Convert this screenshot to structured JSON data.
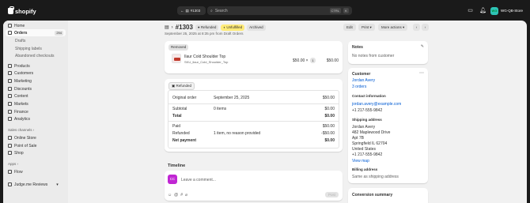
{
  "topbar": {
    "brand": "shopify",
    "order_pill": "#1303",
    "search_placeholder": "Search",
    "shortcut_1": "CTRL",
    "shortcut_2": "K",
    "store_initials": "WG",
    "store_name": "WG-QB-Store"
  },
  "sidebar": {
    "items": [
      {
        "label": "Home",
        "icon": "home-icon"
      },
      {
        "label": "Orders",
        "icon": "orders-icon",
        "badge": "294"
      },
      {
        "label": "Drafts"
      },
      {
        "label": "Shipping labels"
      },
      {
        "label": "Abandoned checkouts"
      },
      {
        "label": "Products",
        "icon": "tag-icon"
      },
      {
        "label": "Customers",
        "icon": "person-icon"
      },
      {
        "label": "Marketing",
        "icon": "target-icon"
      },
      {
        "label": "Discounts",
        "icon": "discount-icon"
      },
      {
        "label": "Content",
        "icon": "content-icon"
      },
      {
        "label": "Markets",
        "icon": "globe-icon"
      },
      {
        "label": "Finance",
        "icon": "bank-icon"
      },
      {
        "label": "Analytics",
        "icon": "chart-icon"
      }
    ],
    "sales_channels_label": "Sales channels",
    "channels": [
      {
        "label": "Online Store",
        "icon": "store-icon"
      },
      {
        "label": "Point of Sale",
        "icon": "pos-icon"
      },
      {
        "label": "Shop",
        "icon": "shop-icon"
      }
    ],
    "apps_label": "Apps",
    "apps": [
      {
        "label": "Flow",
        "icon": "flow-icon"
      }
    ],
    "judge": {
      "label": "Judge.me Reviews",
      "icon": "judge-icon"
    }
  },
  "order": {
    "number": "#1303",
    "status_refunded": "Refunded",
    "status_unfulfilled": "Unfulfilled",
    "status_archived": "Archived",
    "subtitle": "September 25, 2025 at 8:35 pm from Draft Orders",
    "actions": {
      "edit": "Edit",
      "print": "Print",
      "more": "More actions"
    }
  },
  "removed": {
    "label": "Removed",
    "item_name": "Ilaur Cold Shoulder Top",
    "item_sku": "SKU_ilaur_Cold_Shoulder_Top",
    "item_price": "$50.00 ×",
    "item_qty": "1",
    "item_total": "$50.00"
  },
  "summary": {
    "label": "Refunded",
    "rows": [
      {
        "label": "Original order",
        "detail": "September 25, 2025",
        "amount": "$50.00"
      },
      {
        "label": "Subtotal",
        "detail": "0 items",
        "amount": "$0.00"
      },
      {
        "label": "Total",
        "detail": "",
        "amount": "$0.00"
      },
      {
        "label": "Paid",
        "detail": "",
        "amount": "$50.00"
      },
      {
        "label": "Refunded",
        "detail": "1 item, no reason provided",
        "amount": "-$50.00"
      },
      {
        "label": "Net payment",
        "detail": "",
        "amount": "$0.00"
      }
    ]
  },
  "timeline": {
    "title": "Timeline",
    "avatar": "CC",
    "placeholder": "Leave a comment...",
    "post": "Post"
  },
  "notes": {
    "title": "Notes",
    "text": "No notes from customer"
  },
  "customer": {
    "title": "Customer",
    "name": "Jordan Avery",
    "orders": "3 orders",
    "contact_title": "Contact information",
    "email": "jordan.avery@example.com",
    "phone": "+1 217-555-9842",
    "shipping_title": "Shipping address",
    "address": [
      "Jordan Avery",
      "482 Maplewood Drive",
      "Apt 7B",
      "Springfield IL 62704",
      "United States",
      "+1 217-555-9842"
    ],
    "view_map": "View map",
    "billing_title": "Billing address",
    "billing_text": "Same as shipping address"
  },
  "conversion": {
    "title": "Conversion summary"
  }
}
